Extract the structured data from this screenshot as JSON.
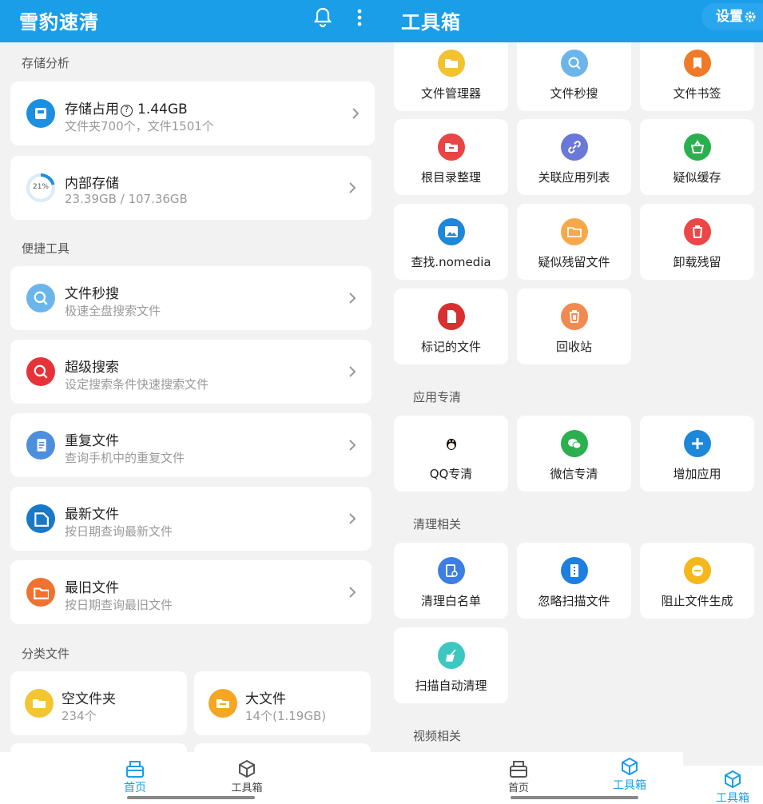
{
  "left": {
    "title": "雪豹速清",
    "section_storage": "存储分析",
    "storage_usage": {
      "title": "存储占用",
      "size": "1.44GB",
      "sub": "文件夹700个，文件1501个"
    },
    "internal": {
      "title": "内部存储",
      "sub": "23.39GB / 107.36GB",
      "percent_label": "21%",
      "percent": 0.21
    },
    "section_tools": "便捷工具",
    "tools": [
      {
        "title": "文件秒搜",
        "sub": "极速全盘搜索文件",
        "icon": "search-icon",
        "color": "#6bb5ea"
      },
      {
        "title": "超级搜索",
        "sub": "设定搜索条件快速搜索文件",
        "icon": "super-search-icon",
        "color": "#e63238"
      },
      {
        "title": "重复文件",
        "sub": "查询手机中的重复文件",
        "icon": "duplicate-file-icon",
        "color": "#4d8fdc"
      },
      {
        "title": "最新文件",
        "sub": "按日期查询最新文件",
        "icon": "new-file-icon",
        "color": "#1a78c8"
      },
      {
        "title": "最旧文件",
        "sub": "按日期查询最旧文件",
        "icon": "old-folder-icon",
        "color": "#ef7230"
      }
    ],
    "section_category": "分类文件",
    "categories": [
      {
        "title": "空文件夹",
        "sub": "234个",
        "icon": "empty-folder-icon",
        "color": "#f4c533"
      },
      {
        "title": "大文件",
        "sub": "14个(1.19GB)",
        "icon": "big-file-icon",
        "color": "#f5a623"
      }
    ],
    "nav": {
      "home": "首页",
      "toolbox": "工具箱"
    }
  },
  "right": {
    "title": "工具箱",
    "settings": "设置",
    "file_tools": [
      {
        "label": "文件管理器",
        "icon": "folder-icon",
        "color": "#f2c230"
      },
      {
        "label": "文件秒搜",
        "icon": "search-icon",
        "color": "#6bb5ea"
      },
      {
        "label": "文件书签",
        "icon": "bookmark-icon",
        "color": "#f07a28"
      },
      {
        "label": "根目录整理",
        "icon": "root-folder-icon",
        "color": "#e84545"
      },
      {
        "label": "关联应用列表",
        "icon": "link-icon",
        "color": "#6a78d8"
      },
      {
        "label": "疑似缓存",
        "icon": "basket-icon",
        "color": "#2ab04f"
      },
      {
        "label": "查找.nomedia",
        "icon": "image-icon",
        "color": "#1d87d9"
      },
      {
        "label": "疑似残留文件",
        "icon": "residual-folder-icon",
        "color": "#f7a94a"
      },
      {
        "label": "卸载残留",
        "icon": "trash-icon",
        "color": "#ec4646"
      },
      {
        "label": "标记的文件",
        "icon": "marked-file-icon",
        "color": "#d83030"
      },
      {
        "label": "回收站",
        "icon": "recycle-bin-icon",
        "color": "#f08a50"
      }
    ],
    "section_app": "应用专清",
    "app_tools": [
      {
        "label": "QQ专清",
        "icon": "qq-penguin-icon",
        "color": "#111111"
      },
      {
        "label": "微信专清",
        "icon": "wechat-icon",
        "color": "#2ab04f"
      },
      {
        "label": "增加应用",
        "icon": "add-icon",
        "color": "#1d87d9"
      }
    ],
    "section_clean": "清理相关",
    "clean_tools": [
      {
        "label": "清理白名单",
        "icon": "whitelist-icon",
        "color": "#3d7fe0"
      },
      {
        "label": "忽略扫描文件",
        "icon": "ignore-file-icon",
        "color": "#1d7fe0"
      },
      {
        "label": "阻止文件生成",
        "icon": "block-icon",
        "color": "#f5b81c"
      },
      {
        "label": "扫描自动清理",
        "icon": "broom-icon",
        "color": "#3cc8c0"
      }
    ],
    "section_video": "视频相关",
    "nav": {
      "home": "首页",
      "toolbox": "工具箱",
      "toolbox_partial": "工具箱"
    }
  },
  "colors": {
    "primary": "#1a9ee8",
    "background": "#f2f2f2",
    "card": "#ffffff"
  }
}
